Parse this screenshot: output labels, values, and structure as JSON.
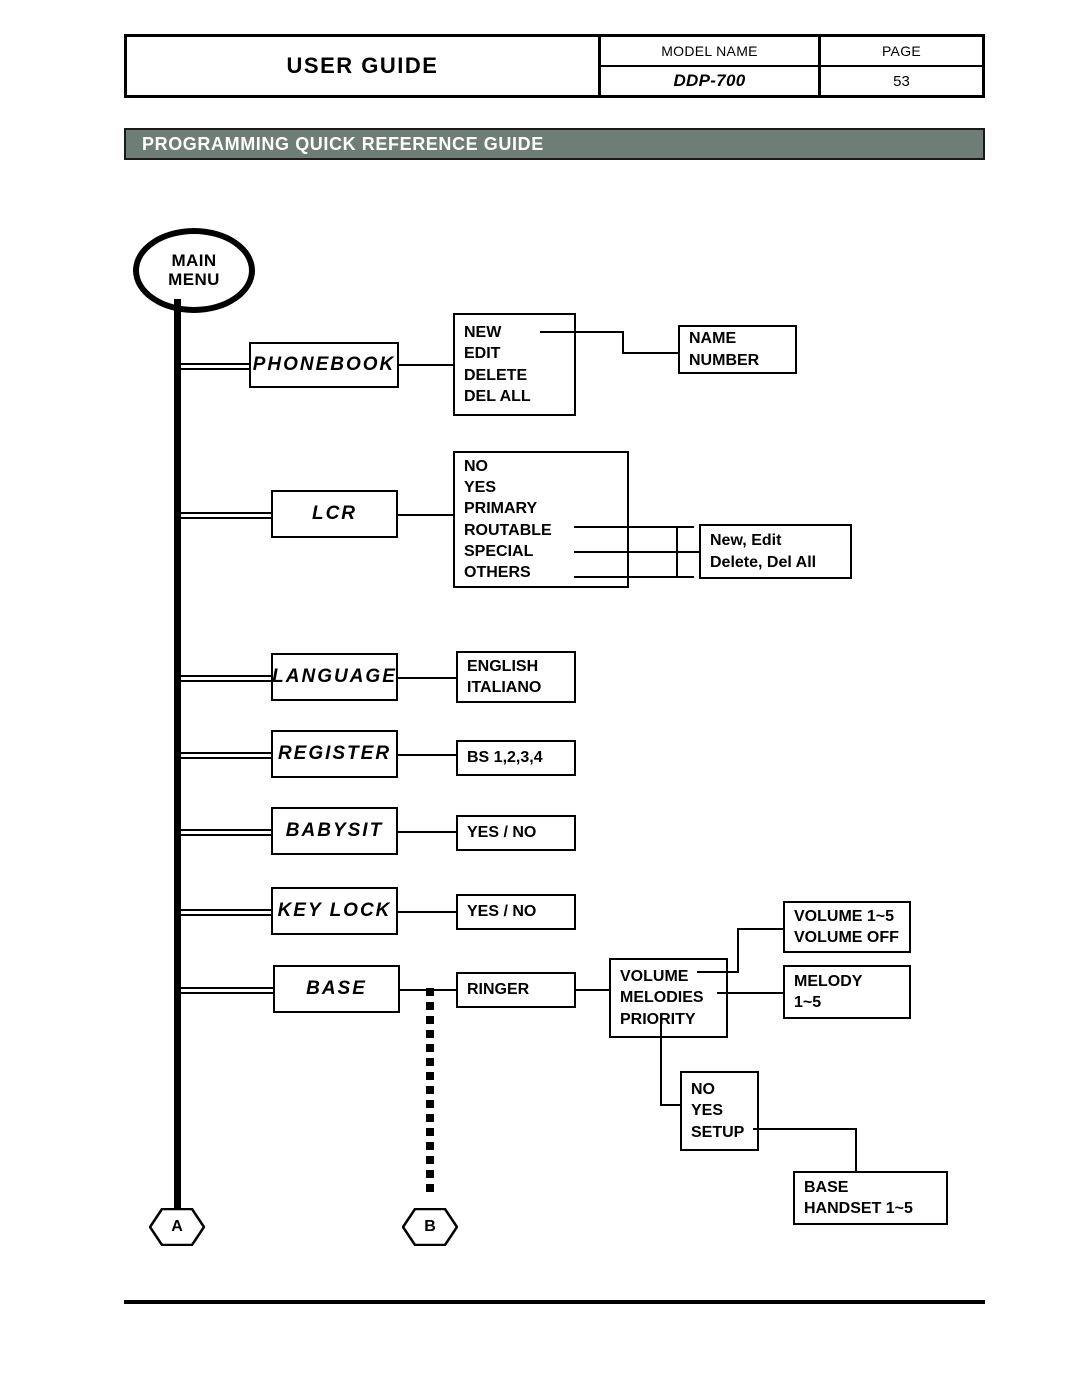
{
  "header": {
    "guide_title": "USER GUIDE",
    "model_label": "MODEL NAME",
    "model_value": "DDP-700",
    "page_label": "PAGE",
    "page_value": "53"
  },
  "section": {
    "title": "PROGRAMMING QUICK REFERENCE GUIDE",
    "bar_color": "#6e7d75",
    "text_color": "#ffffff"
  },
  "diagram": {
    "root": {
      "line1": "MAIN",
      "line2": "MENU"
    },
    "menu_items": [
      {
        "label": "PHONEBOOK"
      },
      {
        "label": "LCR"
      },
      {
        "label": "LANGUAGE"
      },
      {
        "label": "REGISTER"
      },
      {
        "label": "BABYSIT"
      },
      {
        "label": "KEY LOCK"
      },
      {
        "label": "BASE"
      }
    ],
    "phonebook_options": [
      "NEW",
      "EDIT",
      "DELETE",
      "DEL ALL"
    ],
    "phonebook_detail": [
      "NAME",
      "NUMBER"
    ],
    "lcr_options": [
      "NO",
      "YES",
      "PRIMARY",
      "ROUTABLE",
      "SPECIAL",
      "OTHERS"
    ],
    "lcr_detail": [
      "New, Edit",
      "Delete, Del All"
    ],
    "language_options": [
      "ENGLISH",
      "ITALIANO"
    ],
    "register_options": [
      "BS 1,2,3,4"
    ],
    "babysit_options": [
      "YES / NO"
    ],
    "keylock_options": [
      "YES / NO"
    ],
    "base_child": "RINGER",
    "ringer_options": [
      "VOLUME",
      "MELODIES",
      "PRIORITY"
    ],
    "volume_detail": [
      "VOLUME 1~5",
      "VOLUME OFF"
    ],
    "melody_detail": [
      "MELODY",
      "1~5"
    ],
    "priority_options": [
      "NO",
      "YES",
      "SETUP"
    ],
    "setup_detail": [
      "BASE",
      "HANDSET 1~5"
    ],
    "connectors": [
      {
        "id": "A",
        "label": "A"
      },
      {
        "id": "B",
        "label": "B"
      }
    ]
  }
}
